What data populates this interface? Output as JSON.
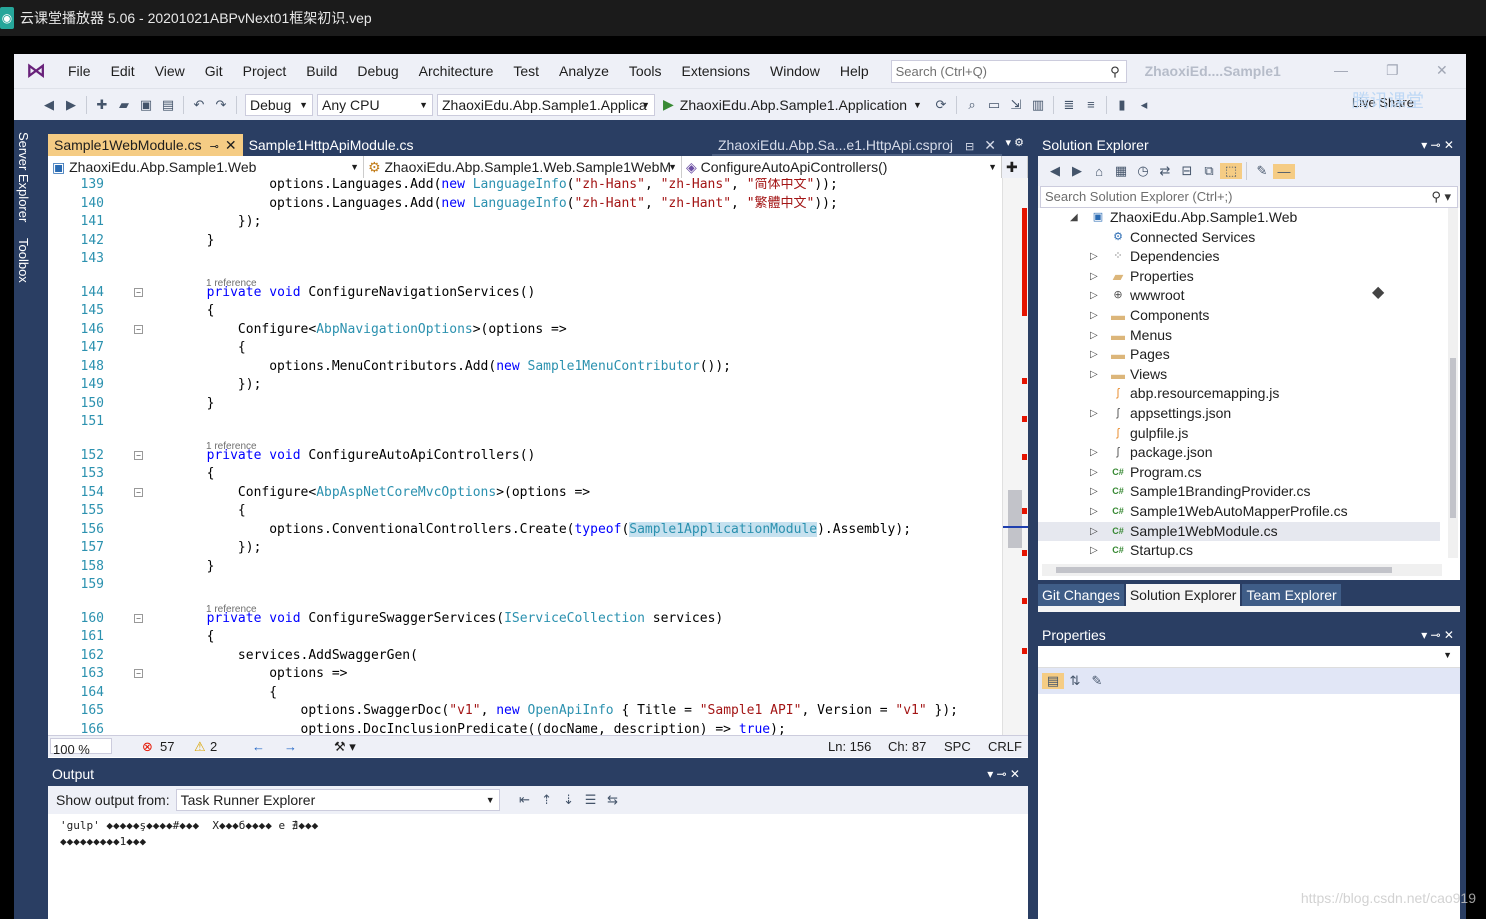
{
  "player": {
    "title": "云课堂播放器 5.06 - 20201021ABPvNext01框架初识.vep",
    "icon": "player-icon"
  },
  "menubar": {
    "items": [
      "File",
      "Edit",
      "View",
      "Git",
      "Project",
      "Build",
      "Debug",
      "Architecture",
      "Test",
      "Analyze",
      "Tools",
      "Extensions",
      "Window",
      "Help"
    ],
    "search_placeholder": "Search (Ctrl+Q)",
    "solution_name": "ZhaoxiEd....Sample1"
  },
  "toolbar": {
    "config": "Debug",
    "platform": "Any CPU",
    "startup_project": "ZhaoxiEdu.Abp.Sample1.Applica",
    "run_target": "ZhaoxiEdu.Abp.Sample1.Application",
    "live_share": "Live Share",
    "watermark": "腾讯课堂"
  },
  "left_tabs": [
    "Server Explorer",
    "Toolbox"
  ],
  "editor": {
    "tabs": {
      "active": "Sample1WebModule.cs",
      "second": "Sample1HttpApiModule.cs",
      "preview": "ZhaoxiEdu.Abp.Sa...e1.HttpApi.csproj"
    },
    "nav": {
      "project": "ZhaoxiEdu.Abp.Sample1.Web",
      "type": "ZhaoxiEdu.Abp.Sample1.Web.Sample1WebM",
      "member": "ConfigureAutoApiControllers()"
    },
    "ref_label": "1 reference",
    "status": {
      "zoom": "100 %",
      "errors": "57",
      "warnings": "2",
      "ln": "Ln: 156",
      "ch": "Ch: 87",
      "spc": "SPC",
      "crlf": "CRLF"
    },
    "lines": [
      {
        "n": "139",
        "c": "                options.Languages.Add(new LanguageInfo(\"zh-Hans\", \"zh-Hans\", \"简体中文\"));"
      },
      {
        "n": "140",
        "c": "                options.Languages.Add(new LanguageInfo(\"zh-Hant\", \"zh-Hant\", \"繁體中文\"));"
      },
      {
        "n": "141",
        "c": "            });"
      },
      {
        "n": "142",
        "c": "        }"
      },
      {
        "n": "143",
        "c": ""
      },
      {
        "n": "144",
        "c": "        private void ConfigureNavigationServices()"
      },
      {
        "n": "145",
        "c": "        {"
      },
      {
        "n": "146",
        "c": "            Configure<AbpNavigationOptions>(options =>"
      },
      {
        "n": "147",
        "c": "            {"
      },
      {
        "n": "148",
        "c": "                options.MenuContributors.Add(new Sample1MenuContributor());"
      },
      {
        "n": "149",
        "c": "            });"
      },
      {
        "n": "150",
        "c": "        }"
      },
      {
        "n": "151",
        "c": ""
      },
      {
        "n": "152",
        "c": "        private void ConfigureAutoApiControllers()"
      },
      {
        "n": "153",
        "c": "        {"
      },
      {
        "n": "154",
        "c": "            Configure<AbpAspNetCoreMvcOptions>(options =>"
      },
      {
        "n": "155",
        "c": "            {"
      },
      {
        "n": "156",
        "c": "                options.ConventionalControllers.Create(typeof(Sample1ApplicationModule).Assembly);"
      },
      {
        "n": "157",
        "c": "            });"
      },
      {
        "n": "158",
        "c": "        }"
      },
      {
        "n": "159",
        "c": ""
      },
      {
        "n": "160",
        "c": "        private void ConfigureSwaggerServices(IServiceCollection services)"
      },
      {
        "n": "161",
        "c": "        {"
      },
      {
        "n": "162",
        "c": "            services.AddSwaggerGen("
      },
      {
        "n": "163",
        "c": "                options =>"
      },
      {
        "n": "164",
        "c": "                {"
      },
      {
        "n": "165",
        "c": "                    options.SwaggerDoc(\"v1\", new OpenApiInfo { Title = \"Sample1 API\", Version = \"v1\" });"
      },
      {
        "n": "166",
        "c": "                    options.DocInclusionPredicate((docName, description) => true);"
      }
    ]
  },
  "output": {
    "title": "Output",
    "show_from_label": "Show output from:",
    "source": "Task Runner Explorer",
    "text_line1": "'gulp' ◆◆◆◆◆ş◆◆◆◆#◆◆◆  X◆◆◆б◆◆◆◆ e ∄◆◆◆",
    "text_line2": "◆◆◆◆◆◆◆◆◆1◆◆◆"
  },
  "solution_explorer": {
    "title": "Solution Explorer",
    "search_placeholder": "Search Solution Explorer (Ctrl+;)",
    "root": "ZhaoxiEdu.Abp.Sample1.Web",
    "items": [
      {
        "label": "Connected Services",
        "icon": "connected-services-icon"
      },
      {
        "label": "Dependencies",
        "icon": "dependencies-icon"
      },
      {
        "label": "Properties",
        "icon": "properties-folder-icon"
      },
      {
        "label": "wwwroot",
        "icon": "globe-icon"
      },
      {
        "label": "Components",
        "icon": "folder-icon"
      },
      {
        "label": "Menus",
        "icon": "folder-icon"
      },
      {
        "label": "Pages",
        "icon": "folder-icon"
      },
      {
        "label": "Views",
        "icon": "folder-icon"
      },
      {
        "label": "abp.resourcemapping.js",
        "icon": "js-file-icon"
      },
      {
        "label": "appsettings.json",
        "icon": "json-file-icon"
      },
      {
        "label": "gulpfile.js",
        "icon": "js-file-icon"
      },
      {
        "label": "package.json",
        "icon": "json-file-icon"
      },
      {
        "label": "Program.cs",
        "icon": "cs-file-icon"
      },
      {
        "label": "Sample1BrandingProvider.cs",
        "icon": "cs-file-icon"
      },
      {
        "label": "Sample1WebAutoMapperProfile.cs",
        "icon": "cs-file-icon"
      },
      {
        "label": "Sample1WebModule.cs",
        "icon": "cs-file-icon"
      },
      {
        "label": "Startup.cs",
        "icon": "cs-file-icon"
      }
    ],
    "bottom_tabs": [
      "Git Changes",
      "Solution Explorer",
      "Team Explorer"
    ]
  },
  "properties": {
    "title": "Properties"
  },
  "csdn_watermark": "https://blog.csdn.net/cao919",
  "colors": {
    "vs_frame": "#2a3e63",
    "active_tab": "#f5cc84",
    "keyword": "#0000ff",
    "type": "#2b91af",
    "string": "#a31515"
  }
}
